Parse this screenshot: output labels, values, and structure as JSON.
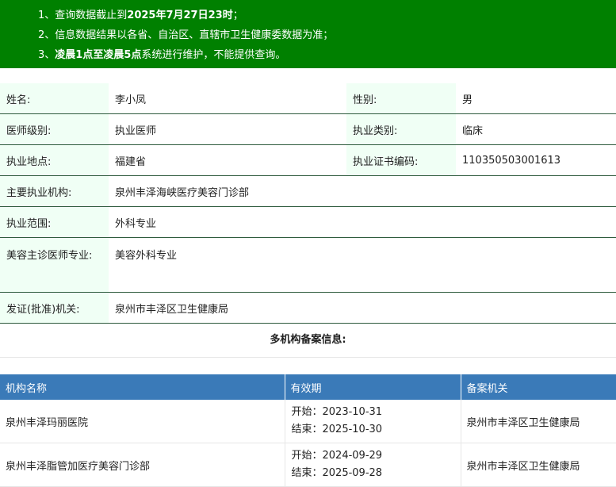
{
  "notice": {
    "line1_prefix": "1、查询数据截止到",
    "line1_bold": "2025年7月27日23时",
    "line1_suffix": "；",
    "line2": "2、信息数据结果以各省、自治区、直辖市卫生健康委数据为准；",
    "line3_prefix": "3、",
    "line3_bold": "凌晨1点至凌晨5点",
    "line3_suffix": "系统进行维护，不能提供查询。"
  },
  "info": {
    "name_label": "姓名:",
    "name_value": "李小凤",
    "gender_label": "性别:",
    "gender_value": "男",
    "level_label": "医师级别:",
    "level_value": "执业医师",
    "category_label": "执业类别:",
    "category_value": "临床",
    "location_label": "执业地点:",
    "location_value": "福建省",
    "cert_label": "执业证书编码:",
    "cert_value": "110350503001613",
    "institution_label": "主要执业机构:",
    "institution_value": "泉州丰泽海峡医疗美容门诊部",
    "scope_label": "执业范围:",
    "scope_value": "外科专业",
    "cosmetic_label": "美容主诊医师专业:",
    "cosmetic_value": "美容外科专业",
    "authority_label": "发证(批准)机关:",
    "authority_value": "泉州市丰泽区卫生健康局"
  },
  "multi_title": "多机构备案信息:",
  "institutions": {
    "headers": [
      "机构名称",
      "有效期",
      "备案机关"
    ],
    "rows": [
      {
        "name": "泉州丰泽玛丽医院",
        "start": "开始：2023-10-31",
        "end": "结束：2025-10-30",
        "authority": "泉州市丰泽区卫生健康局"
      },
      {
        "name": "泉州丰泽脂管加医疗美容门诊部",
        "start": "开始：2024-09-29",
        "end": "结束：2025-09-28",
        "authority": "泉州市丰泽区卫生健康局"
      }
    ]
  }
}
